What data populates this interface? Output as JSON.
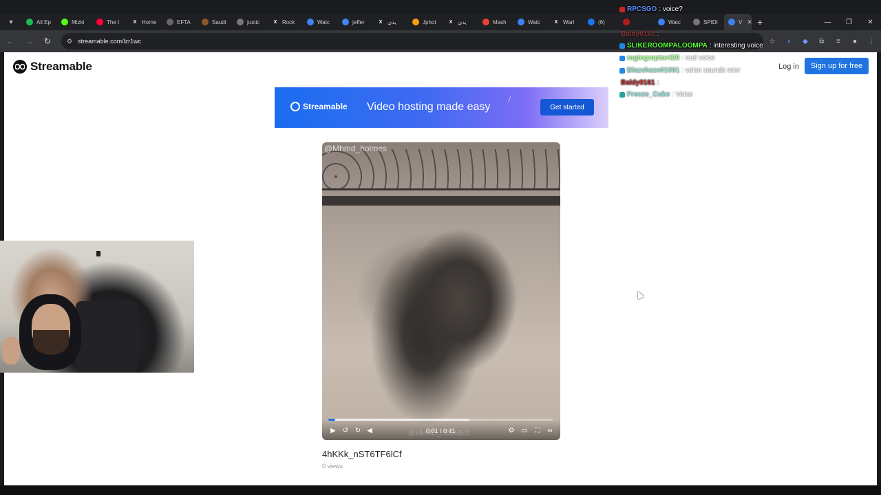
{
  "browser": {
    "tabs": [
      {
        "title": "All Ep",
        "color": "#1db954"
      },
      {
        "title": "Mizki",
        "color": "#53fc18"
      },
      {
        "title": "The I",
        "color": "#ff0033"
      },
      {
        "title": "Home",
        "color": "#444444",
        "glyph": "X"
      },
      {
        "title": "EFTA",
        "color": "#666666"
      },
      {
        "title": "Saudi",
        "color": "#8a5a2b"
      },
      {
        "title": "justic",
        "color": "#777777"
      },
      {
        "title": "Rock",
        "color": "#444444",
        "glyph": "X"
      },
      {
        "title": "Watc",
        "color": "#3b82f6"
      },
      {
        "title": "jeffer",
        "color": "#4285f4"
      },
      {
        "title": "يدي",
        "color": "#444444",
        "glyph": "X"
      },
      {
        "title": "Jphot",
        "color": "#f59e0b"
      },
      {
        "title": "يدي",
        "color": "#444444",
        "glyph": "X"
      },
      {
        "title": "Mash",
        "color": "#ea4335"
      },
      {
        "title": "Watc",
        "color": "#3b82f6"
      },
      {
        "title": "Warl",
        "color": "#444444",
        "glyph": "X"
      },
      {
        "title": "(6)",
        "color": "#1877f2"
      },
      {
        "title": "",
        "color": "#b71c1c"
      },
      {
        "title": "Watc",
        "color": "#3b82f6"
      },
      {
        "title": "SPIDI",
        "color": "#777777"
      },
      {
        "title": "V",
        "color": "#3b82f6",
        "active": true
      }
    ],
    "new_tab_label": "+",
    "url": "streamable.com/lzr1wc"
  },
  "site": {
    "logo_text": "Streamable",
    "login_label": "Log in",
    "signup_label": "Sign up for free"
  },
  "banner": {
    "logo_text": "Streamable",
    "headline": "Video hosting made easy",
    "cta_label": "Get started"
  },
  "video": {
    "watermark": "@Mhmd_holmes",
    "control_watermark": "@MHMD_HOLMES",
    "current_time": "0:01",
    "duration": "0:41",
    "timecode": "0:01 / 0:41",
    "played_fraction": 0.03,
    "buffered_fraction": 0.63,
    "title": "4hKKk_nST6TF6lCf",
    "views": "0 views"
  },
  "chat": [
    {
      "name": "RPCSGO",
      "message": ": voice?",
      "name_color": "#5b8cff",
      "badge": "#c62828"
    },
    {
      "name": "Baldy0161",
      "message": ":",
      "name_color": "#d23c3c",
      "badge": "",
      "faded": true
    },
    {
      "name": "SLIKEROOMPALOOMPA",
      "message": ": interesting voice",
      "name_color": "#5bff3c",
      "badge": "#1e88e5"
    },
    {
      "name": "ragingraptor420",
      "message": ": real voice",
      "name_color": "#5bff3c",
      "badge": "#1e88e5",
      "faded": true
    },
    {
      "name": "Blazehaze01001",
      "message": ": voice sounds wier",
      "name_color": "#41d8b0",
      "badge": "#1e88e5",
      "faded": true
    },
    {
      "name": "Baldy0161",
      "message": ":",
      "name_color": "#d23c3c",
      "badge": ""
    },
    {
      "name": "Freeze_Cube",
      "message": ": Voice",
      "name_color": "#35c4c4",
      "badge": "#26a69a",
      "faded": true
    }
  ]
}
